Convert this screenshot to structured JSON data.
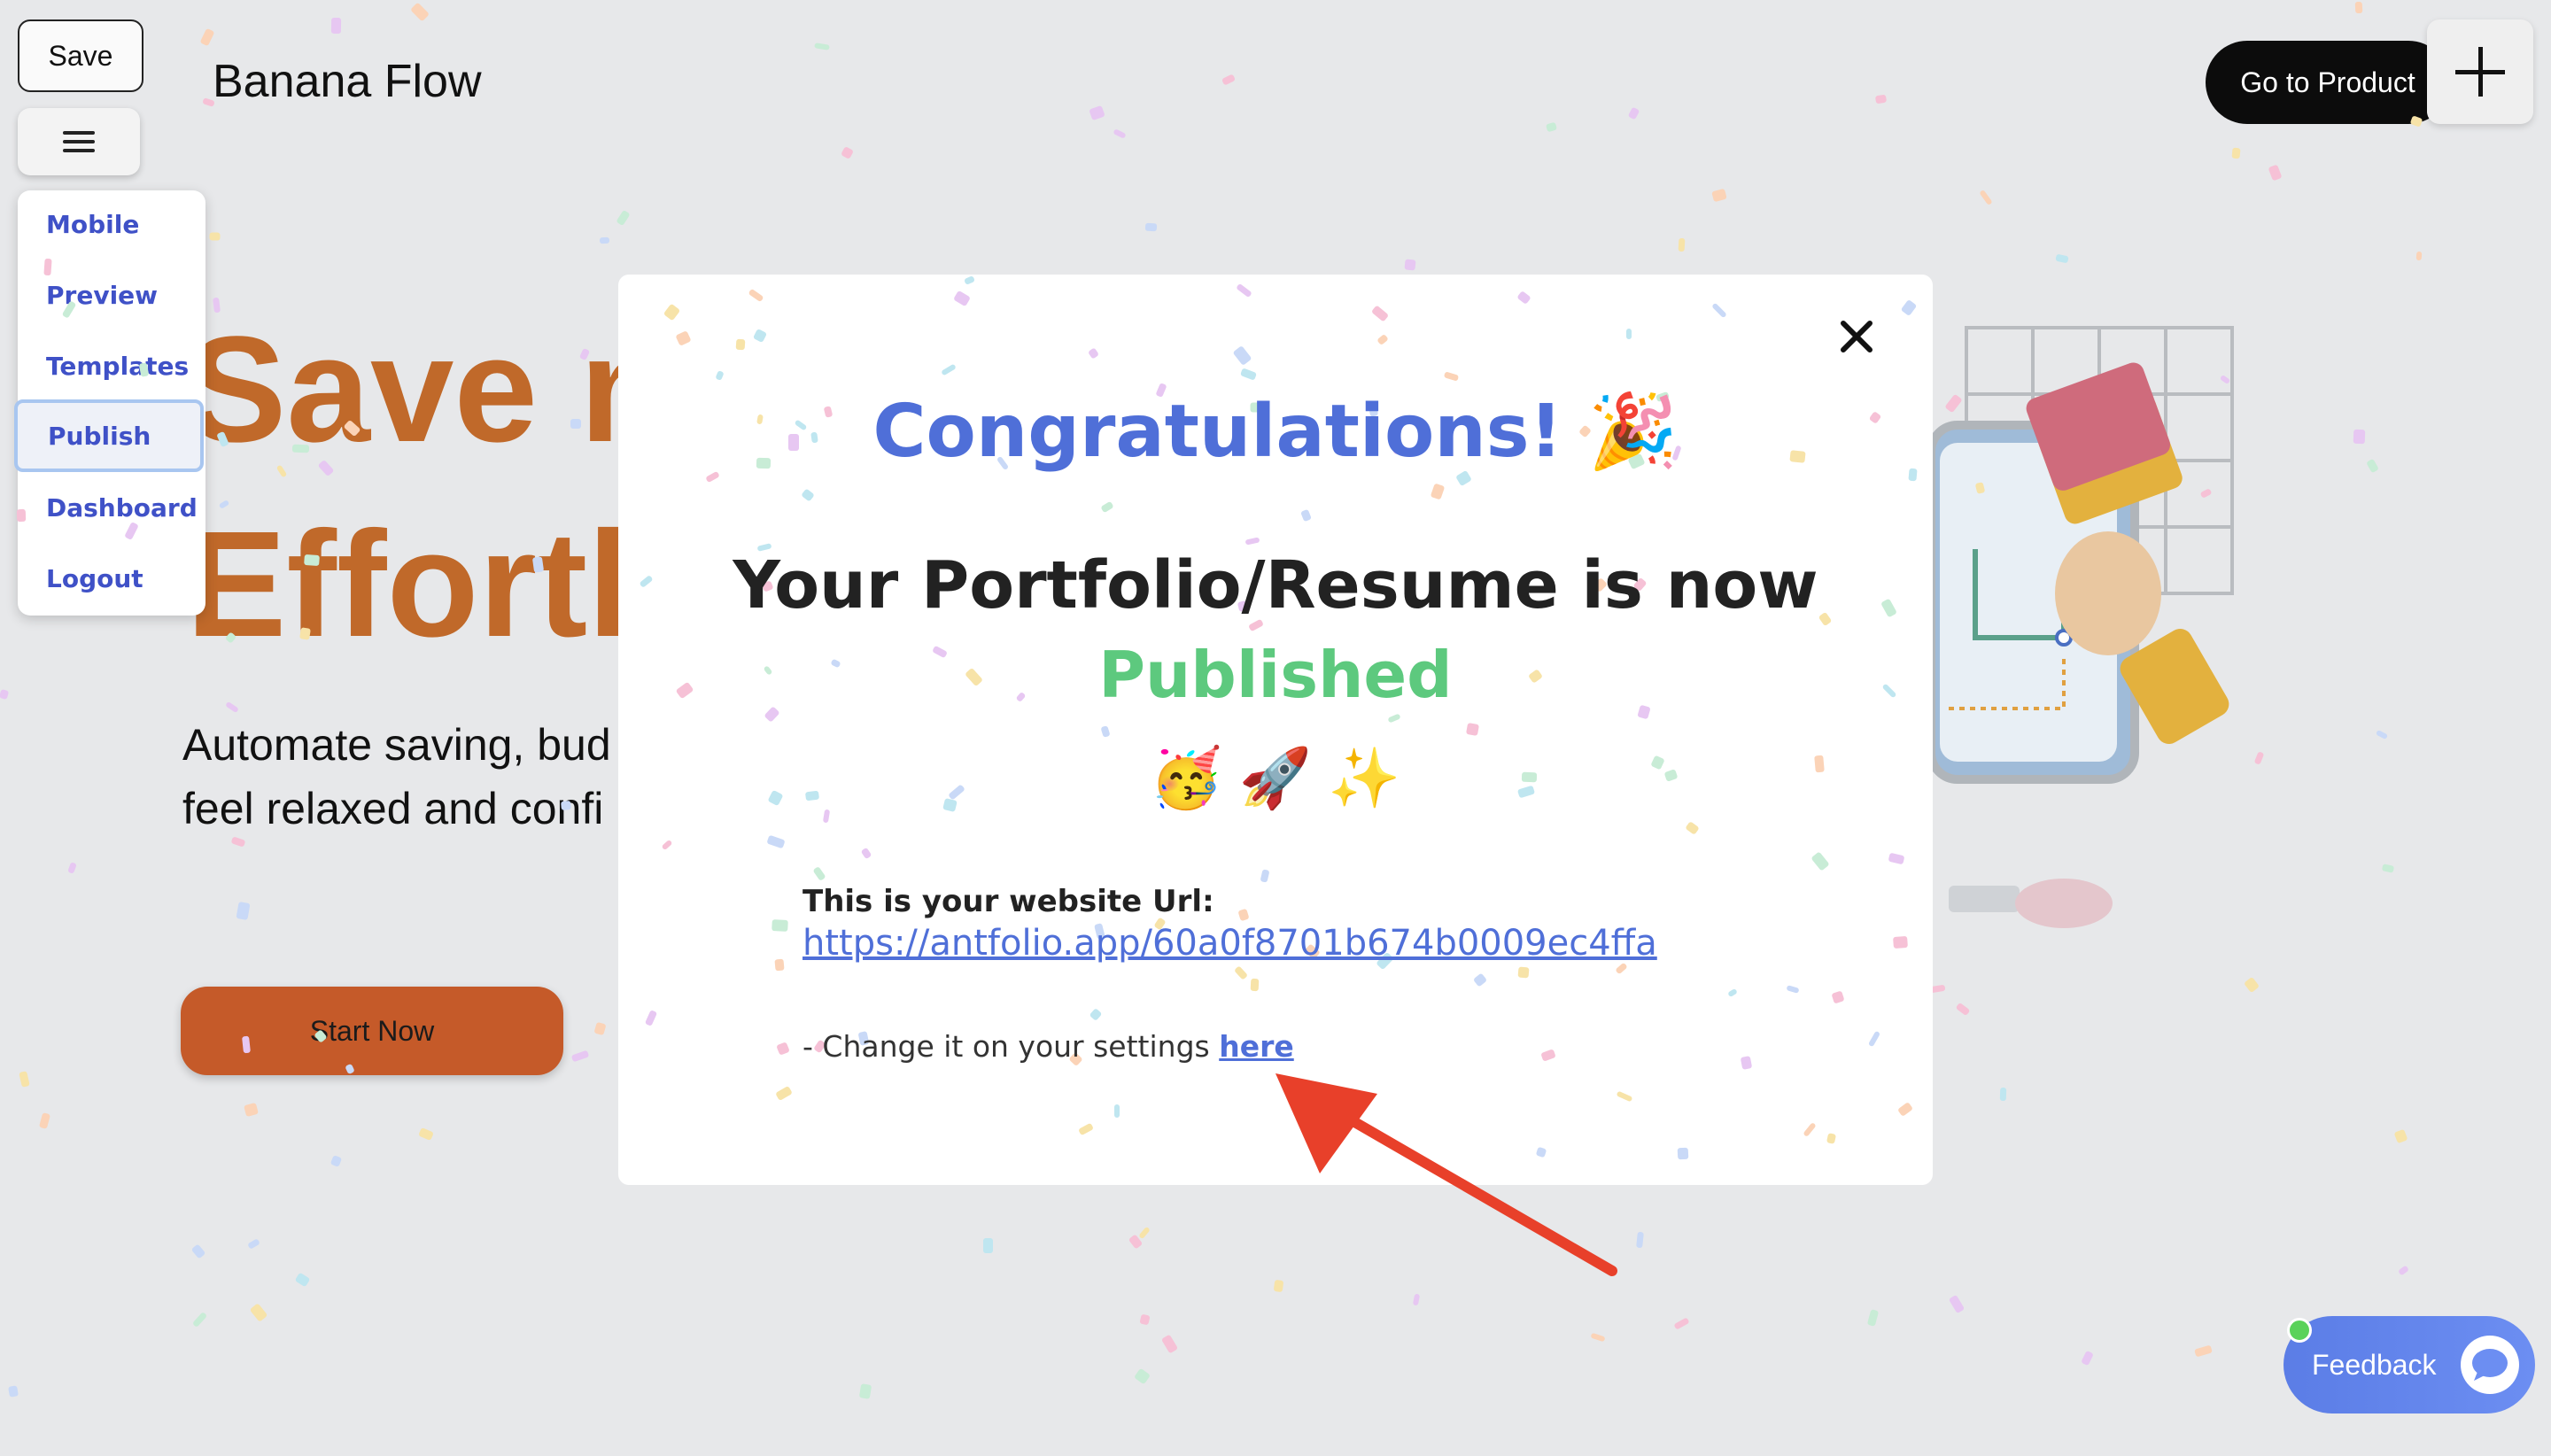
{
  "app": {
    "brand": "Banana Flow",
    "save_label": "Save",
    "go_to_product_label": "Go to Product"
  },
  "menu": {
    "items": [
      {
        "label": "Mobile"
      },
      {
        "label": "Preview"
      },
      {
        "label": "Templates"
      },
      {
        "label": "Publish"
      },
      {
        "label": "Dashboard"
      },
      {
        "label": "Logout"
      }
    ],
    "active": "Publish"
  },
  "hero": {
    "title_line1": "Save m",
    "title_line2": "Effortle",
    "subtitle_line1": "Automate saving, bud",
    "subtitle_line2": "feel relaxed and confi",
    "cta_label": "Start Now",
    "title_color": "#c0692a",
    "cta_color": "#c55a29"
  },
  "modal": {
    "heading": "Congratulations!",
    "heading_emoji": "🎉",
    "line1": "Your Portfolio/Resume is now",
    "status": "Published",
    "emojis": "🥳 🚀 ✨",
    "url_label": "This is your website Url:",
    "url": "https://antfolio.app/60a0f8701b674b0009ec4ffa",
    "settings_prefix": "- Change it on your settings",
    "settings_link": "here",
    "accent_color": "#4f6fd8",
    "status_color": "#5dc97e"
  },
  "feedback": {
    "label": "Feedback"
  },
  "icons": [
    "hamburger-icon",
    "plus-icon",
    "close-icon",
    "chat-bubble-icon",
    "arrow-annotation-icon"
  ]
}
